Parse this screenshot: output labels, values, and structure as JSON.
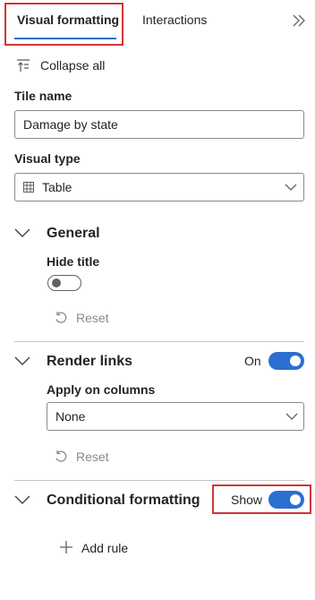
{
  "tabs": {
    "visual_formatting": "Visual formatting",
    "interactions": "Interactions"
  },
  "collapse_all": "Collapse all",
  "tile_name": {
    "label": "Tile name",
    "value": "Damage by state"
  },
  "visual_type": {
    "label": "Visual type",
    "value": "Table"
  },
  "general": {
    "title": "General",
    "hide_title_label": "Hide title",
    "hide_title_enabled": false,
    "reset": "Reset"
  },
  "render_links": {
    "title": "Render links",
    "state_label": "On",
    "enabled": true,
    "apply_on_columns_label": "Apply on columns",
    "apply_on_columns_value": "None",
    "reset": "Reset"
  },
  "conditional_formatting": {
    "title": "Conditional formatting",
    "state_label": "Show",
    "enabled": true,
    "add_rule": "Add rule"
  },
  "colors": {
    "accent": "#2b6fd1",
    "highlight_box": "#d13438"
  }
}
